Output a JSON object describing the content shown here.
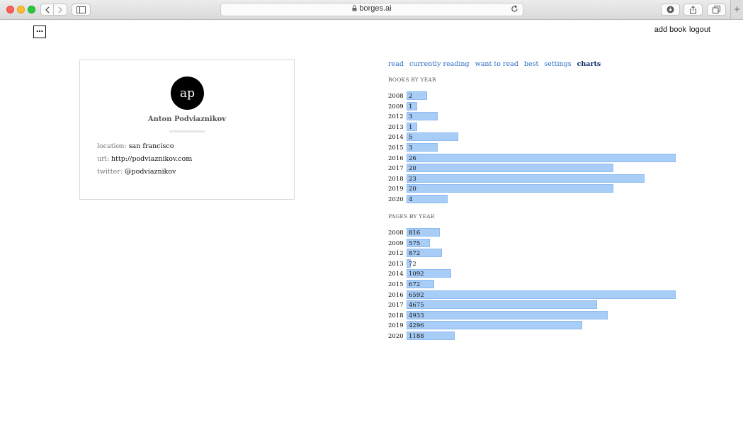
{
  "browser": {
    "url": "borges.ai"
  },
  "header": {
    "menu_glyph": "…",
    "add_book": "add book",
    "logout": "logout"
  },
  "profile": {
    "initials": "ap",
    "name": "Anton Podviaznikov",
    "location_label": "location:",
    "location": "san francisco",
    "url_label": "url:",
    "url": "http://podviaznikov.com",
    "twitter_label": "twitter:",
    "twitter": "@podviaznikov"
  },
  "nav": {
    "tabs": [
      {
        "label": "read",
        "active": false
      },
      {
        "label": "currently reading",
        "active": false
      },
      {
        "label": "want to read",
        "active": false
      },
      {
        "label": "best",
        "active": false
      },
      {
        "label": "settings",
        "active": false
      },
      {
        "label": "charts",
        "active": true
      }
    ]
  },
  "chart_data": [
    {
      "type": "bar",
      "title": "BOOKS BY YEAR",
      "categories": [
        "2008",
        "2009",
        "2012",
        "2013",
        "2014",
        "2015",
        "2016",
        "2017",
        "2018",
        "2019",
        "2020"
      ],
      "values": [
        2,
        1,
        3,
        1,
        5,
        3,
        26,
        20,
        23,
        20,
        4
      ]
    },
    {
      "type": "bar",
      "title": "PAGES BY YEAR",
      "categories": [
        "2008",
        "2009",
        "2012",
        "2013",
        "2014",
        "2015",
        "2016",
        "2017",
        "2018",
        "2019",
        "2020"
      ],
      "values": [
        816,
        575,
        872,
        72,
        1092,
        672,
        6592,
        4675,
        4933,
        4296,
        1188
      ]
    }
  ]
}
